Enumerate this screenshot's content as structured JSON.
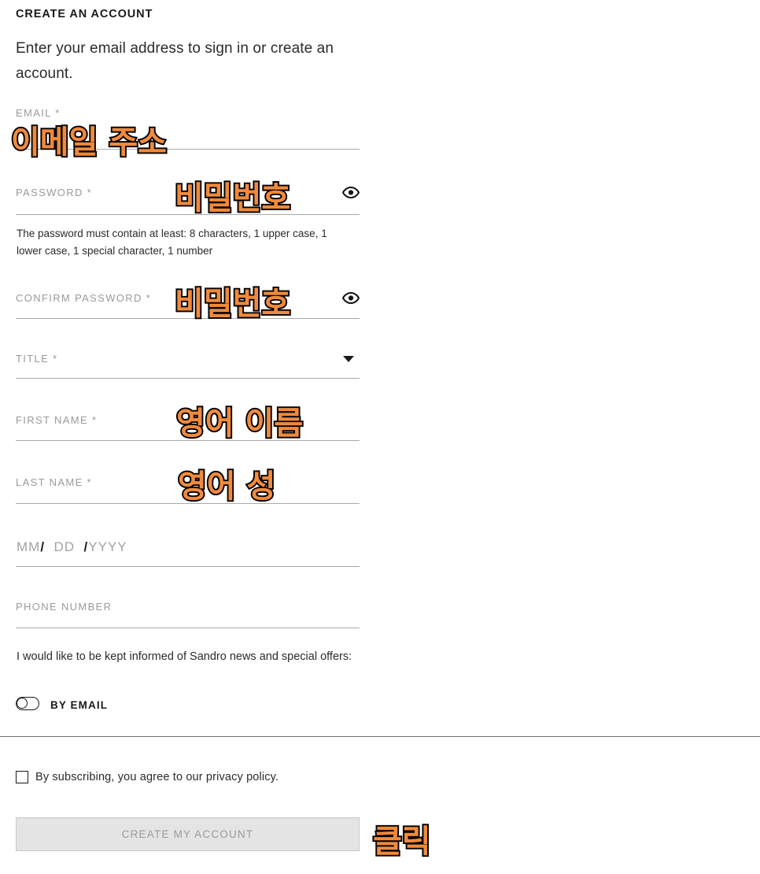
{
  "page": {
    "heading": "CREATE AN ACCOUNT",
    "intro": "Enter your email address to sign in or create an account.",
    "brand": "Sandro",
    "accent_color": "#F08A3C",
    "outline_color": "#000000",
    "background": "#ffffff"
  },
  "form": {
    "fields": [
      {
        "label": "EMAIL *",
        "value": "",
        "placeholder": "",
        "type": "email"
      },
      {
        "label": "PASSWORD *",
        "value": "",
        "placeholder": "",
        "type": "password",
        "reveal_icon": "eye-icon"
      },
      {
        "label": "CONFIRM PASSWORD *",
        "value": "",
        "placeholder": "",
        "type": "password",
        "reveal_icon": "eye-icon"
      },
      {
        "label": "TITLE *",
        "value": "",
        "placeholder": "",
        "type": "select",
        "dropdown_icon": "chevron-down-icon"
      },
      {
        "label": "FIRST NAME *",
        "value": "",
        "placeholder": "",
        "type": "text"
      },
      {
        "label": "LAST NAME *",
        "value": "",
        "placeholder": "",
        "type": "text"
      },
      {
        "label": "PHONE NUMBER",
        "value": "",
        "placeholder": "",
        "type": "tel"
      }
    ],
    "password_helper": "The password must contain at least: 8 characters,  1 upper case,  1 lower case,  1 special character,  1 number",
    "birthdate": {
      "month_placeholder": "MM",
      "separator_1": "/",
      "day_placeholder": "DD",
      "separator_2": "/",
      "year_placeholder": "YYYY"
    }
  },
  "newsletter": {
    "prompt": "I would like to be kept informed of Sandro news and special offers:",
    "toggle_label": "BY EMAIL",
    "toggle_state": "off"
  },
  "consent": {
    "checkbox_label": "By subscribing, you agree to our privacy policy.",
    "checkbox_state": "unchecked"
  },
  "submit": {
    "label": "CREATE MY ACCOUNT",
    "state": "disabled"
  },
  "annotations": [
    {
      "text": "이메일 주소",
      "meaning": "email address"
    },
    {
      "text": "비밀번호",
      "meaning": "password"
    },
    {
      "text": "비밀번호",
      "meaning": "password confirm"
    },
    {
      "text": "영어 이름",
      "meaning": "english first name"
    },
    {
      "text": "영어 성",
      "meaning": "english last name"
    },
    {
      "text": "클릭",
      "meaning": "click"
    }
  ]
}
